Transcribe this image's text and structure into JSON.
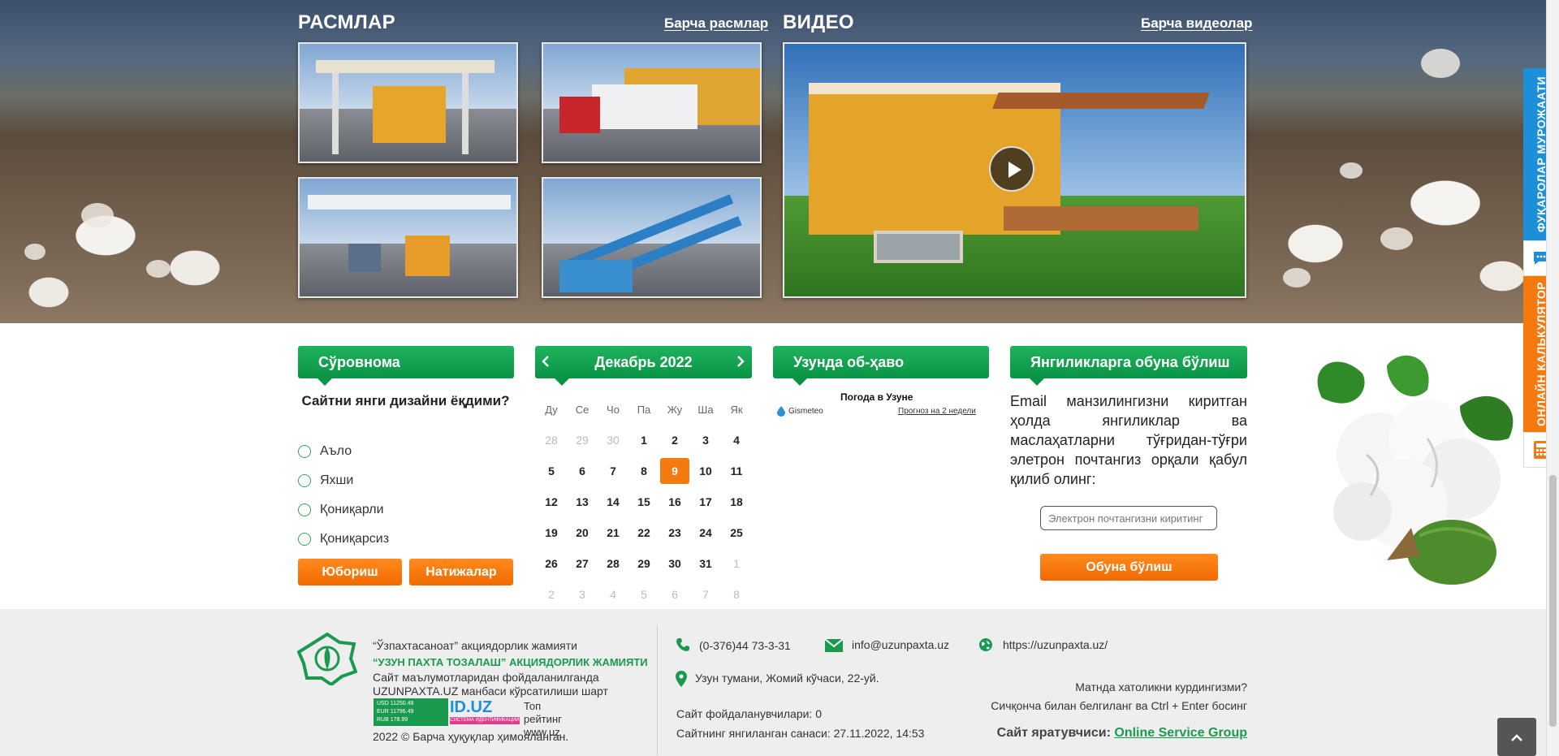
{
  "gallery": {
    "photos_title": "РАСМЛАР",
    "all_photos_link": "Барча расмлар",
    "video_title": "ВИДЕО",
    "all_videos_link": "Барча видеолар"
  },
  "side_tabs": {
    "citizen_appeals": "ФУҚАРОЛАР МУРОЖААТИ",
    "online_calculator": "ОНЛАЙН КАЛЬКУЛЯТОР"
  },
  "survey": {
    "title": "Сўровнома",
    "question": "Сайтни янги дизайни ёқдими?",
    "options": [
      "Аъло",
      "Яхши",
      "Қониқарли",
      "Қониқарсиз"
    ],
    "submit_label": "Юбориш",
    "results_label": "Натижалар"
  },
  "calendar": {
    "month_title": "Декабрь 2022",
    "weekdays": [
      "Ду",
      "Се",
      "Чо",
      "Па",
      "Жу",
      "Ша",
      "Як"
    ],
    "weeks": [
      [
        "28",
        "29",
        "30",
        "1",
        "2",
        "3",
        "4"
      ],
      [
        "5",
        "6",
        "7",
        "8",
        "9",
        "10",
        "11"
      ],
      [
        "12",
        "13",
        "14",
        "15",
        "16",
        "17",
        "18"
      ],
      [
        "19",
        "20",
        "21",
        "22",
        "23",
        "24",
        "25"
      ],
      [
        "26",
        "27",
        "28",
        "29",
        "30",
        "31",
        "1"
      ],
      [
        "2",
        "3",
        "4",
        "5",
        "6",
        "7",
        "8"
      ]
    ],
    "today": "9"
  },
  "weather": {
    "title": "Узунда об-ҳаво",
    "widget_title": "Погода в Узуне",
    "source": "Gismeteo",
    "forecast_link": "Прогноз на 2 недели"
  },
  "subscribe": {
    "title": "Янгиликларга обуна бўлиш",
    "text": "Email манзилингизни киритган ҳолда янгиликлар ва маслаҳатларни тўғридан-тўғри элетрон почтангиз орқали қабул қилиб олинг:",
    "placeholder": "Электрон почтангизни киритинг",
    "button": "Обуна бўлиш"
  },
  "footer": {
    "org_line1": "“Ўзпахтасаноат” акциядорлик жамияти",
    "org_line2": "“УЗУН ПАХТА ТОЗАЛАШ” АКЦИЯДОРЛИК ЖАМИЯТИ",
    "notice_line1": "Сайт маълумотларидан фойдаланилганда",
    "notice_line2": "UZUNPAXTA.UZ манбаси кўрсатилиши шарт",
    "rates": [
      {
        "code": "USD",
        "value": "11250.49"
      },
      {
        "code": "EUR",
        "value": "11796.49"
      },
      {
        "code": "RUB",
        "value": "178.99"
      }
    ],
    "id_badge": "ID.UZ",
    "id_badge_sub": "СИСТЕМА ИДЕНТИФИКАЦИИ",
    "top_rating_alt": "Топ рейтинг www.uz",
    "copyright": "2022 © Барча ҳуқуқлар ҳимояланган.",
    "phone": "(0-376)44 73-3-31",
    "email": "info@uzunpaxta.uz",
    "website": "https://uzunpaxta.uz/",
    "address": "Узун тумани, Жомий кўчаси, 22-уй.",
    "visitors": "Сайт фойдаланувчилари: 0",
    "updated": "Сайтнинг янгиланган санаси: 27.11.2022, 14:53",
    "error_hint1": "Матнда хатоликни курдингизми?",
    "error_hint2": "Сичқонча билан белгиланг ва Ctrl + Enter босинг",
    "creator_label": "Сайт яратувчиси:",
    "creator_link": "Online Service Group"
  },
  "colors": {
    "accent_green": "#0a9345",
    "accent_orange": "#f47a0f",
    "side_blue": "#1c8fd8"
  }
}
